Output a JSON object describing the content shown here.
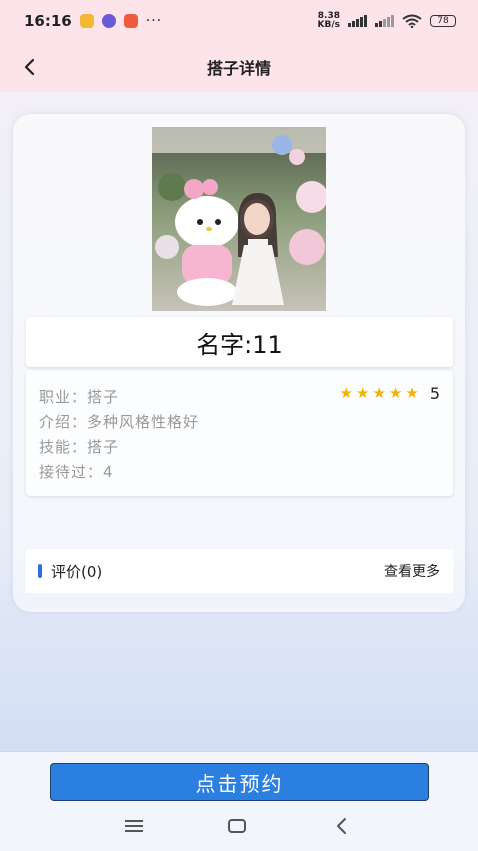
{
  "status_bar": {
    "time": "16:16",
    "dots": "···",
    "net_speed_top": "8.38",
    "net_speed_bottom": "KB/s",
    "battery": "78"
  },
  "header": {
    "title": "搭子详情",
    "back_icon": "chevron-left-icon"
  },
  "profile": {
    "name": "名字:11",
    "rating_value": "5",
    "stars": 5,
    "star_color": "#f5b300",
    "rows": [
      {
        "label": "职业：",
        "value": "搭子"
      },
      {
        "label": "介绍：",
        "value": "多种风格性格好"
      },
      {
        "label": "技能：",
        "value": "搭子"
      },
      {
        "label": "接待过：",
        "value": "4"
      }
    ]
  },
  "reviews": {
    "title": "评价(0)",
    "more": "查看更多"
  },
  "actions": {
    "book_label": "点击预约",
    "accent": "#2a7fe0"
  },
  "system_nav": {
    "menu_icon": "menu-icon",
    "home_icon": "home-icon",
    "back_icon": "back-icon"
  }
}
